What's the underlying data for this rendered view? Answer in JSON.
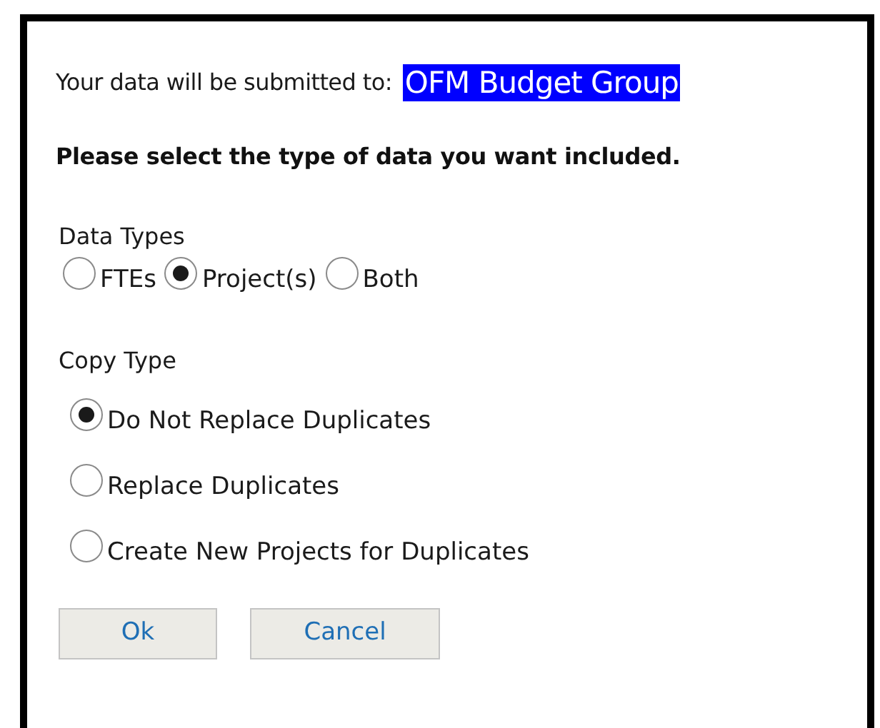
{
  "submit_line": {
    "label": "Your data will be submitted to:",
    "target": "OFM Budget Group"
  },
  "instruction": "Please select the type of data you want included.",
  "data_types": {
    "label": "Data Types",
    "options": [
      {
        "label": "FTEs",
        "selected": false
      },
      {
        "label": "Project(s)",
        "selected": true
      },
      {
        "label": "Both",
        "selected": false
      }
    ]
  },
  "copy_type": {
    "label": "Copy Type",
    "options": [
      {
        "label": "Do Not Replace Duplicates",
        "selected": true
      },
      {
        "label": "Replace Duplicates",
        "selected": false
      },
      {
        "label": "Create New Projects for Duplicates",
        "selected": false
      }
    ]
  },
  "buttons": [
    "Ok",
    "Cancel"
  ]
}
